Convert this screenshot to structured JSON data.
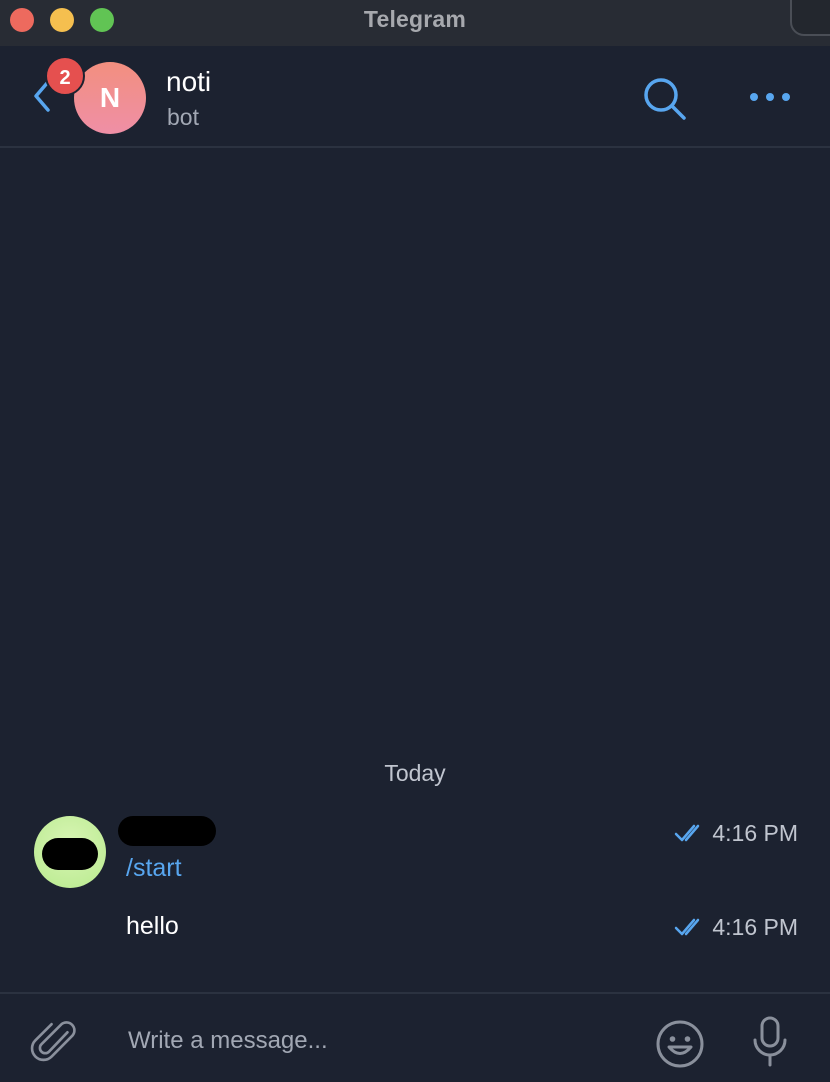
{
  "window": {
    "title": "Telegram"
  },
  "header": {
    "unread_count": "2",
    "avatar_initial": "N",
    "chat_name": "noti",
    "chat_status": "bot"
  },
  "messages": {
    "date_separator": "Today",
    "items": [
      {
        "text": "/start",
        "time": "4:16 PM",
        "status": "read"
      },
      {
        "text": "hello",
        "time": "4:16 PM",
        "status": "read"
      }
    ]
  },
  "composer": {
    "placeholder": "Write a message..."
  },
  "colors": {
    "accent": "#58a6ef",
    "badge": "#e5504f",
    "background": "#1c2230"
  }
}
